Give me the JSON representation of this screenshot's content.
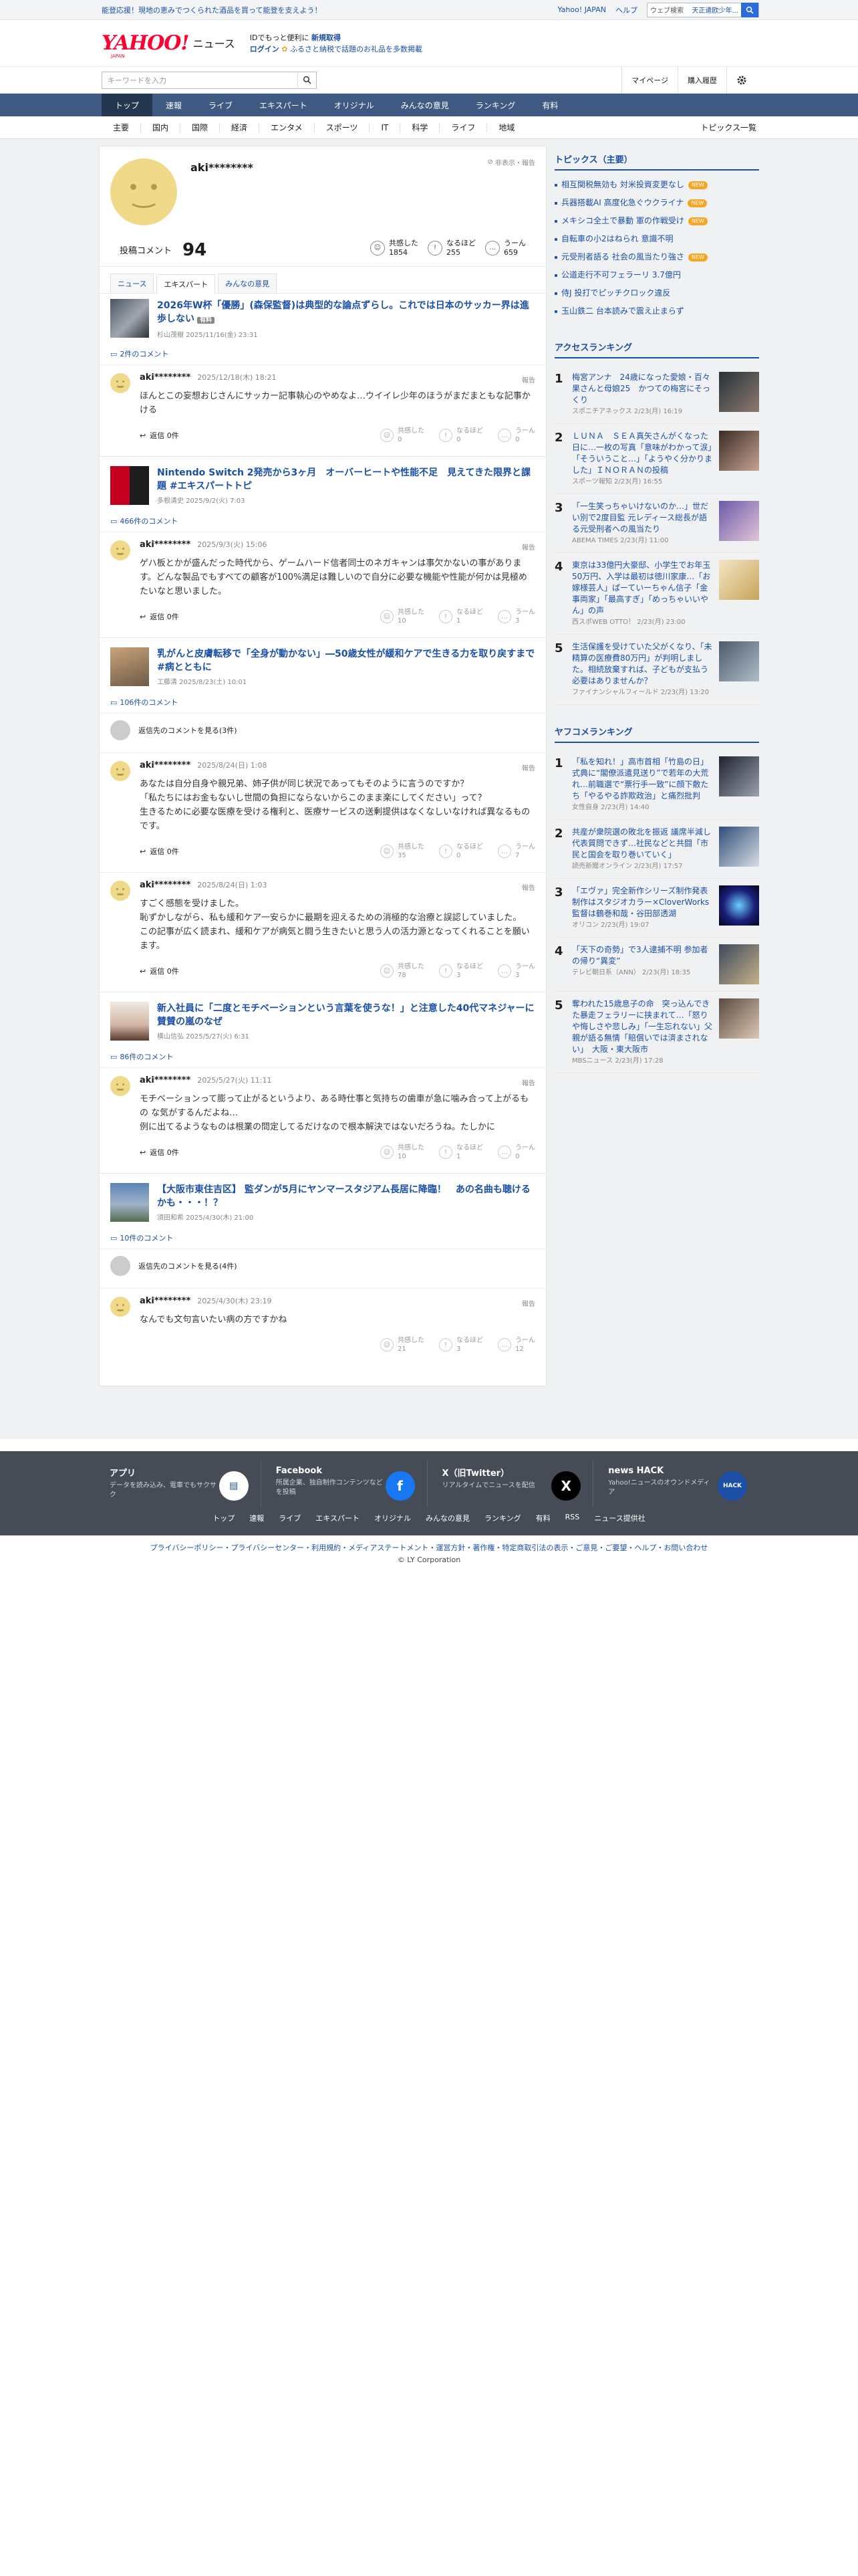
{
  "top_bar": {
    "promo": "能登応援！現地の恵みでつくられた酒品を買って能登を支えよう！",
    "links": [
      "Yahoo! JAPAN",
      "ヘルプ"
    ],
    "search_placeholder": "ウェブ検索",
    "search_value": "天正遣欧少年..."
  },
  "header": {
    "logo_text": "YAHOO!",
    "logo_sub": "JAPAN",
    "service": "ニュース",
    "tag_line1_pre": "IDでもっと便利に",
    "tag_line1_link": "新規取得",
    "tag_line2_link": "ログイン",
    "tag_line2_rest": "ふるさと納税で話題のお礼品を多数掲載"
  },
  "search": {
    "placeholder": "キーワードを入力",
    "mypage": "マイページ",
    "history": "購入履歴"
  },
  "nav_main": [
    "トップ",
    "速報",
    "ライブ",
    "エキスパート",
    "オリジナル",
    "みんなの意見",
    "ランキング",
    "有料"
  ],
  "nav_sub": [
    "主要",
    "国内",
    "国際",
    "経済",
    "エンタメ",
    "スポーツ",
    "IT",
    "科学",
    "ライフ",
    "地域"
  ],
  "nav_sub_right": "トピックス一覧",
  "profile": {
    "name": "aki********",
    "hide_label": "非表示・報告",
    "posts_label": "投稿コメント",
    "posts_count": "94",
    "reactions": [
      {
        "label": "共感した",
        "value": "1854"
      },
      {
        "label": "なるほど",
        "value": "255"
      },
      {
        "label": "うーん",
        "value": "659"
      }
    ]
  },
  "tabs": [
    "ニュース",
    "エキスパート",
    "みんなの意見"
  ],
  "articles": [
    {
      "title": "2026年W杯「優勝」(森保監督)は典型的な論点ずらし。これでは日本のサッカー界は進歩しない",
      "badge": "有料",
      "source": "杉山茂樹 2025/11/16(金) 23:31",
      "count": "2件のコメント",
      "comments": [
        {
          "user": "aki********",
          "date": "2025/12/18(木) 18:21",
          "body": "ほんとこの妄想おじさんにサッカー記事執心のやめなよ…ウイイレ少年のほうがまだまともな記事かける",
          "replies": "返信 0件",
          "votes": [
            {
              "l": "共感した",
              "v": "0"
            },
            {
              "l": "なるほど",
              "v": "0"
            },
            {
              "l": "うーん",
              "v": "0"
            }
          ]
        }
      ]
    },
    {
      "title": "Nintendo Switch 2発売から3ヶ月　オーバーヒートや性能不足　見えてきた限界と課題 #エキスパートトピ",
      "badge": "",
      "source": "多根清史 2025/9/2(火) 7:03",
      "count": "466件のコメント",
      "comments": [
        {
          "user": "aki********",
          "date": "2025/9/3(火) 15:06",
          "body": "ゲハ板とかが盛んだった時代から、ゲームハード信者同士のネガキャンは事欠かないの事があります。どんな製品でもすべての顧客が100%満足は難しいので自分に必要な機能や性能が何かは見極めたいなと思いました。",
          "replies": "返信 0件",
          "votes": [
            {
              "l": "共感した",
              "v": "10"
            },
            {
              "l": "なるほど",
              "v": "1"
            },
            {
              "l": "うーん",
              "v": "3"
            }
          ]
        }
      ]
    },
    {
      "title": "乳がんと皮膚転移で「全身が動かない」―50歳女性が緩和ケアで生きる力を取り戻すまで #病とともに",
      "badge": "",
      "source": "工藤清 2025/8/23(土) 10:01",
      "count": "106件のコメント",
      "more": "返信先のコメントを見る(3件)",
      "comments": [
        {
          "user": "aki********",
          "date": "2025/8/24(日) 1:08",
          "body": "あなたは自分自身や親兄弟、姉子供が同じ状況であってもそのように言うのですか？\n「私たちにはお金もないし世間の負担にならないからこのまま楽にしてください」って？\n生きるために必要な医療を受ける権利と、医療サービスの送剰提供はなくなしいなければ異なるものです。",
          "replies": "返信 0件",
          "votes": [
            {
              "l": "共感した",
              "v": "35"
            },
            {
              "l": "なるほど",
              "v": "0"
            },
            {
              "l": "うーん",
              "v": "7"
            }
          ]
        },
        {
          "user": "aki********",
          "date": "2025/8/24(日) 1:03",
          "body": "すごく感態を受けました。\n恥ずかしながら、私も緩和ケア一安らかに最期を迎えるための消極的な治療と誤認していました。\nこの記事が広く読まれ、緩和ケアが病気と闘う生きたいと思う人の活力源となってくれることを願います。",
          "replies": "返信 0件",
          "votes": [
            {
              "l": "共感した",
              "v": "78"
            },
            {
              "l": "なるほど",
              "v": "3"
            },
            {
              "l": "うーん",
              "v": "3"
            }
          ]
        }
      ]
    },
    {
      "title": "新入社員に「二度とモチベーションという言葉を使うな！」と注意した40代マネジャーに賛賛の嵐のなぜ",
      "badge": "",
      "source": "横山信弘 2025/5/27(火) 6:31",
      "count": "86件のコメント",
      "comments": [
        {
          "user": "aki********",
          "date": "2025/5/27(火) 11:11",
          "body": "モチベーションって膨って止がるというより、ある時仕事と気持ちの歯車が急に噛み合って上がるもの な気がするんだよね…\n例に出てるようなものは根業の問定してるだけなので根本解決ではないだろうね。たしかに",
          "replies": "返信 0件",
          "votes": [
            {
              "l": "共感した",
              "v": "10"
            },
            {
              "l": "なるほど",
              "v": "1"
            },
            {
              "l": "うーん",
              "v": "0"
            }
          ]
        }
      ]
    },
    {
      "title": "【大阪市東住吉区】 監ダンが5月にヤンマースタジアム長居に降臨！　あの名曲も聴けるかも・・・！？",
      "badge": "",
      "source": "須田和希 2025/4/30(木) 21:00",
      "count": "10件のコメント",
      "more": "返信先のコメントを見る(4件)",
      "comments": [
        {
          "user": "aki********",
          "date": "2025/4/30(木) 23:19",
          "body": "なんでも文句言いたい病の方ですかね",
          "replies": "",
          "votes": [
            {
              "l": "共感した",
              "v": "21"
            },
            {
              "l": "なるほど",
              "v": "3"
            },
            {
              "l": "うーん",
              "v": "12"
            }
          ]
        }
      ]
    }
  ],
  "report_label": "報告",
  "side": {
    "topics_title": "トピックス（主要）",
    "topics": [
      {
        "t": "相互関税無効も 対米投資変更なし",
        "new": true
      },
      {
        "t": "兵器搭載AI 高度化急ぐウクライナ",
        "new": true
      },
      {
        "t": "メキシコ全土で暴動 軍の作戦受け",
        "new": true
      },
      {
        "t": "自転車の小2はねられ 意識不明",
        "new": false
      },
      {
        "t": "元受刑者語る 社会の風当たり強さ",
        "new": true
      },
      {
        "t": "公道走行不可フェラーリ 3.7億円",
        "new": false
      },
      {
        "t": "侍J 投打でピッチクロック違反",
        "new": false
      },
      {
        "t": "玉山鉄二 台本読みで震え止まらず",
        "new": false
      }
    ],
    "access_title": "アクセスランキング",
    "access": [
      {
        "t": "梅宮アンナ　24歳になった愛娘・百々果さんと母娘25　かつての梅宮にそっくり",
        "s": "スポニチアネックス 2/23(月) 16:19"
      },
      {
        "t": "ＬＵＮＡ　ＳＥＡ真矢さんがくなった日に…一枚の写真「意味がわかって涙」「そういうこと…」「ようやく分かりました」ＩＮＯＲＡＮの投稿",
        "s": "スポーツ報知 2/23(月) 16:55"
      },
      {
        "t": "「一生笑っちゃいけないのか…」世だい別で2度目監 元レディース総長が語る元受刑者への風当たり",
        "s": "ABEMA TIMES 2/23(月) 11:00"
      },
      {
        "t": "東京は33億円大豪邸、小学生でお年玉50万円、入学は最初は徳川家康…「お嫁様芸人」ぱーていーちゃん信子「金事両家」「最高すぎ」「めっちゃいいやん」の声",
        "s": "西スポWEB OTTO！ 2/23(月) 23:00"
      },
      {
        "t": "生活保護を受けていた父がくなり、「未精算の医療費80万円」が判明しました。相続放棄すれば、子どもが支払う必要はありませんか？",
        "s": "ファイナンシャルフィールド 2/23(月) 13:20"
      }
    ],
    "comment_title": "ヤフコメランキング",
    "comment_rank": [
      {
        "t": "「私を知れ！」高市首相「竹島の日」式典に“閣僚派遣見送り”で若年の大荒れ…前職選で“票行手一致”に顔下敷たち「やるやる詐欺政治」と痛烈批判",
        "s": "女性自身 2/23(月) 14:40"
      },
      {
        "t": "共産が衆院選の敗北を振返 議席半減し代表質問できず…社民などと共闘「市民と国会を取り巻いていく」",
        "s": "読売新聞オンライン 2/23(月) 17:57"
      },
      {
        "t": "「エヴァ」完全新作シリーズ制作発表　制作はスタジオカラー×CloverWorks　監督は鶴巻和哉・谷田部透湖",
        "s": "オリコン 2/23(月) 19:07"
      },
      {
        "t": "「天下の奇勢」で3人逮捕不明 参加者の帰り“異変”",
        "s": "テレビ朝日系（ANN） 2/23(月) 18:35"
      },
      {
        "t": "奪われた15歳息子の命　突っ込んできた暴走フェラリーに挟まれて…「怒りや悔しさや悲しみ」「一生忘れない」父親が語る無情「賠償いでは済まされない」　大阪・東大阪市",
        "s": "MBSニュース 2/23(月) 17:28"
      }
    ]
  },
  "footer": {
    "cards": [
      {
        "t": "アプリ",
        "d": "データを読み込み、電車でもサクサク",
        "icon": "app-icon"
      },
      {
        "t": "Facebook",
        "d": "所属企業、独自制作コンテンツなどを投稿",
        "icon": "facebook-icon"
      },
      {
        "t": "X（旧Twitter）",
        "d": "リアルタイムでニュースを配信",
        "icon": "x-icon"
      },
      {
        "t": "news HACK",
        "d": "Yahoo!ニュースのオウンドメディア",
        "icon": "newshack-icon"
      }
    ],
    "links": [
      "トップ",
      "速報",
      "ライブ",
      "エキスパート",
      "オリジナル",
      "みんなの意見",
      "ランキング",
      "有料",
      "RSS",
      "ニュース提供社"
    ],
    "policy": "プライバシーポリシー・プライバシーセンター・利用規約・メディアステートメント・運営方針・著作権・特定商取引法の表示・ご意見・ご要望・ヘルプ・お問い合わせ",
    "copyright": "© LY Corporation"
  }
}
